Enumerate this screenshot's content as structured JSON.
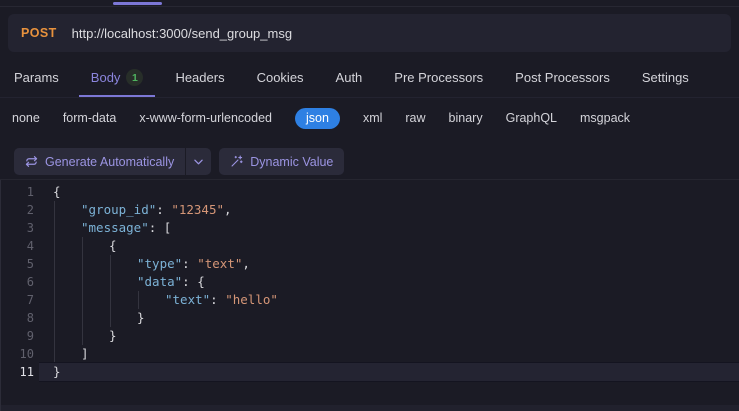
{
  "colors": {
    "accent": "#7c77d6",
    "selected-blue": "#2e80e3",
    "method-orange": "#e8923d",
    "badge-green": "#4fb35f",
    "syntax-key": "#7cb2d6",
    "syntax-string": "#d59677",
    "syntax-punct": "#d8d8dc"
  },
  "request": {
    "method": "POST",
    "url": "http://localhost:3000/send_group_msg"
  },
  "tabs": {
    "active": "Body",
    "items": [
      {
        "label": "Params"
      },
      {
        "label": "Body",
        "badge": "1",
        "active": true
      },
      {
        "label": "Headers"
      },
      {
        "label": "Cookies"
      },
      {
        "label": "Auth"
      },
      {
        "label": "Pre Processors"
      },
      {
        "label": "Post Processors"
      },
      {
        "label": "Settings"
      }
    ]
  },
  "body_types": {
    "selected": "json",
    "items": [
      "none",
      "form-data",
      "x-www-form-urlencoded",
      "json",
      "xml",
      "raw",
      "binary",
      "GraphQL",
      "msgpack"
    ]
  },
  "toolbar": {
    "generate_label": "Generate Automatically",
    "dynamic_value_label": "Dynamic Value"
  },
  "editor": {
    "language": "json",
    "active_line": 11,
    "lines": [
      {
        "num": 1,
        "guides": 0,
        "tokens": [
          {
            "c": "p",
            "t": "{"
          }
        ]
      },
      {
        "num": 2,
        "guides": 1,
        "tokens": [
          {
            "c": "k",
            "t": "\"group_id\""
          },
          {
            "c": "p",
            "t": ": "
          },
          {
            "c": "s",
            "t": "\"12345\""
          },
          {
            "c": "p",
            "t": ","
          }
        ]
      },
      {
        "num": 3,
        "guides": 1,
        "tokens": [
          {
            "c": "k",
            "t": "\"message\""
          },
          {
            "c": "p",
            "t": ": ["
          }
        ]
      },
      {
        "num": 4,
        "guides": 2,
        "tokens": [
          {
            "c": "p",
            "t": "{"
          }
        ]
      },
      {
        "num": 5,
        "guides": 3,
        "tokens": [
          {
            "c": "k",
            "t": "\"type\""
          },
          {
            "c": "p",
            "t": ": "
          },
          {
            "c": "s",
            "t": "\"text\""
          },
          {
            "c": "p",
            "t": ","
          }
        ]
      },
      {
        "num": 6,
        "guides": 3,
        "tokens": [
          {
            "c": "k",
            "t": "\"data\""
          },
          {
            "c": "p",
            "t": ": {"
          }
        ]
      },
      {
        "num": 7,
        "guides": 4,
        "tokens": [
          {
            "c": "k",
            "t": "\"text\""
          },
          {
            "c": "p",
            "t": ": "
          },
          {
            "c": "s",
            "t": "\"hello\""
          }
        ]
      },
      {
        "num": 8,
        "guides": 3,
        "tokens": [
          {
            "c": "p",
            "t": "}"
          }
        ]
      },
      {
        "num": 9,
        "guides": 2,
        "tokens": [
          {
            "c": "p",
            "t": "}"
          }
        ]
      },
      {
        "num": 10,
        "guides": 1,
        "tokens": [
          {
            "c": "p",
            "t": "]"
          }
        ]
      },
      {
        "num": 11,
        "guides": 0,
        "tokens": [
          {
            "c": "p",
            "t": "}"
          }
        ]
      }
    ]
  }
}
